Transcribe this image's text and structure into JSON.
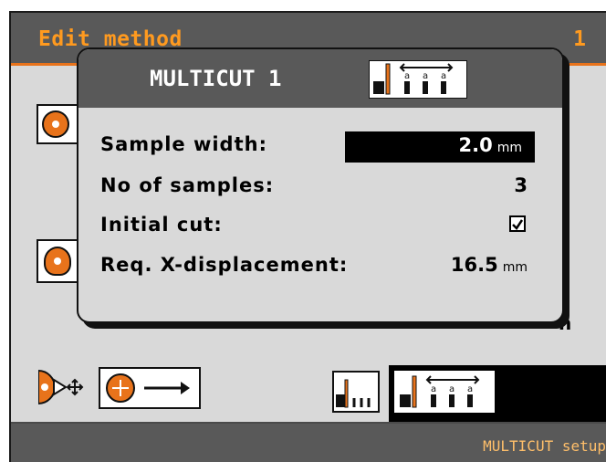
{
  "header": {
    "title": "Edit method",
    "page_number": "1"
  },
  "status": {
    "text": "MULTICUT setup"
  },
  "background": {
    "partial_text": "n"
  },
  "dialog": {
    "title": "MULTICUT 1",
    "icon_labels": [
      "a",
      "a",
      "a"
    ],
    "rows": [
      {
        "label": "Sample width:",
        "value": "2.0",
        "unit": "mm"
      },
      {
        "label": "No of samples:",
        "value": "3"
      },
      {
        "label": "Initial cut:",
        "checked": true
      },
      {
        "label": "Req. X-displacement:",
        "value": "16.5",
        "unit": "mm"
      }
    ]
  },
  "toolbar": {
    "selected_icon": "multicut-icon",
    "small_icon_labels": "III"
  },
  "colors": {
    "accent": "#e8731b",
    "title": "#ff9a1f",
    "frame": "#595959",
    "panel": "#d9d9d9"
  }
}
